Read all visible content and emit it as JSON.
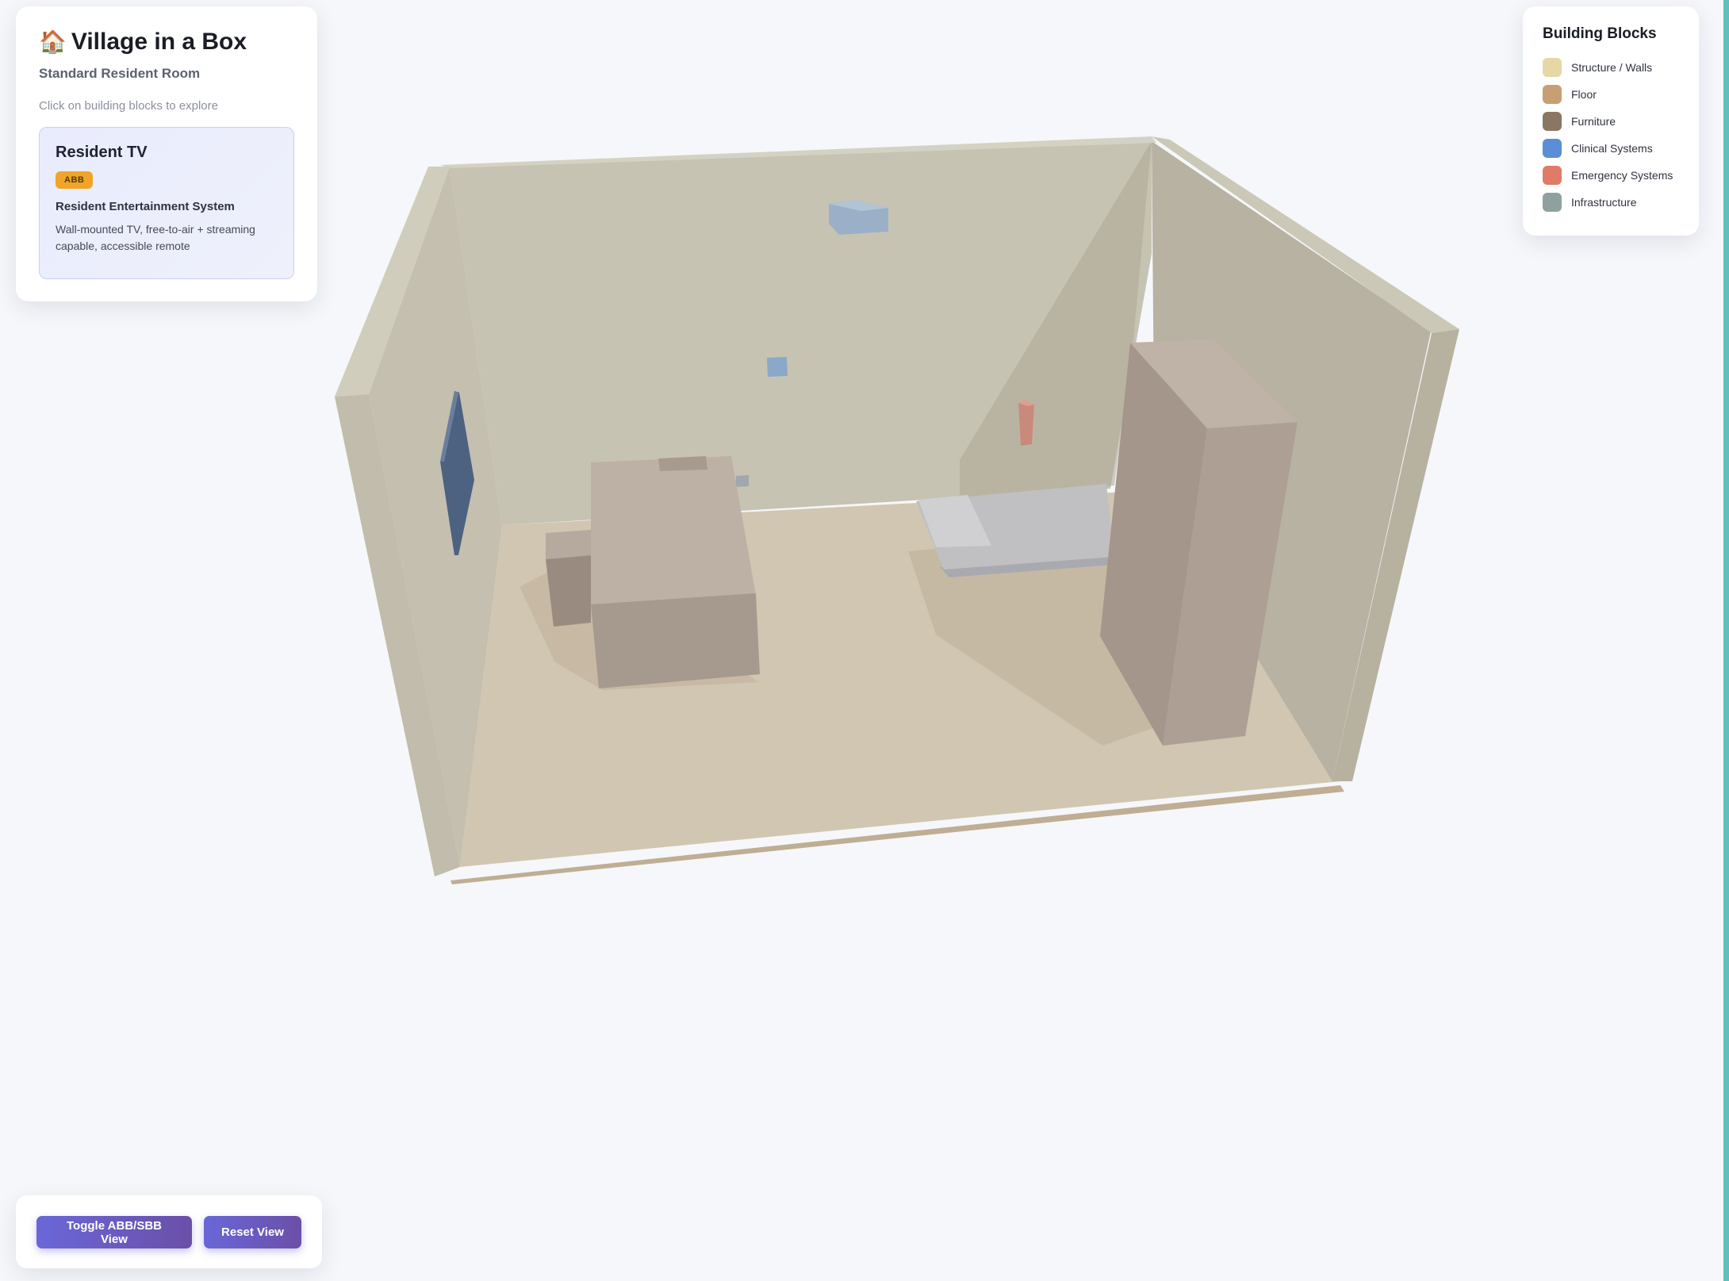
{
  "app": {
    "title": "Village in a Box",
    "subtitle": "Standard Resident Room",
    "hint": "Click on building blocks to explore"
  },
  "selected_block": {
    "title": "Resident TV",
    "badge": "ABB",
    "name": "Resident Entertainment System",
    "description": "Wall-mounted TV, free-to-air + streaming capable, accessible remote"
  },
  "legend": {
    "title": "Building Blocks",
    "items": [
      {
        "label": "Structure / Walls",
        "color": "#e6d7a6"
      },
      {
        "label": "Floor",
        "color": "#c89f73"
      },
      {
        "label": "Furniture",
        "color": "#8b7664"
      },
      {
        "label": "Clinical Systems",
        "color": "#5b8ed6"
      },
      {
        "label": "Emergency Systems",
        "color": "#e07b68"
      },
      {
        "label": "Infrastructure",
        "color": "#8fa19e"
      }
    ]
  },
  "controls": {
    "toggle_label": "Toggle ABB/SBB View",
    "reset_label": "Reset View"
  }
}
